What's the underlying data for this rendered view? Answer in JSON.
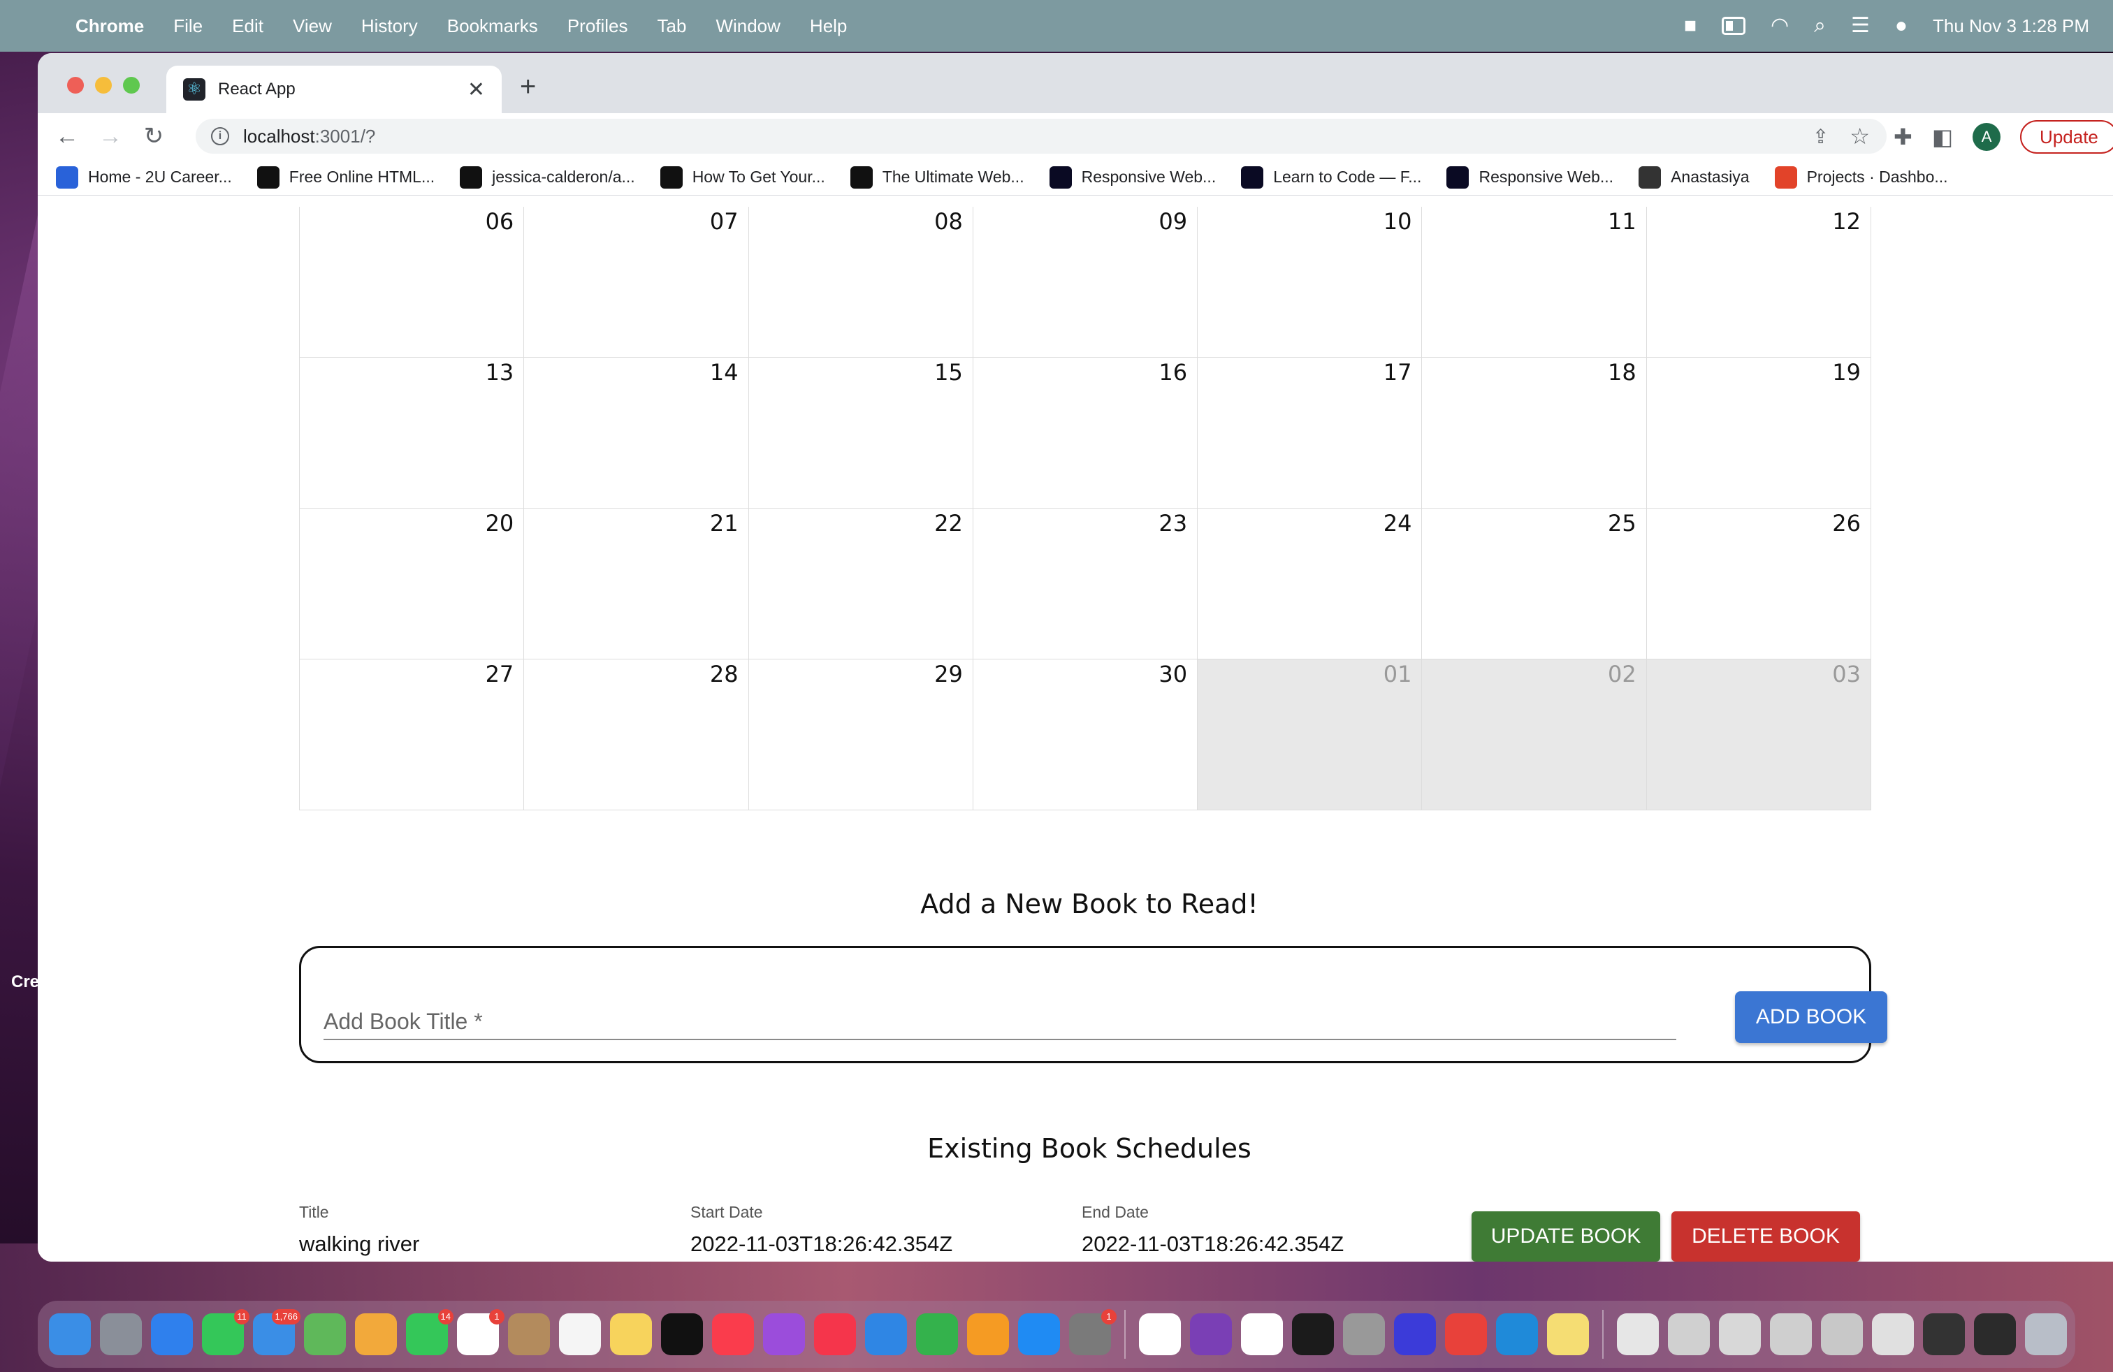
{
  "menubar": {
    "app_name": "Chrome",
    "menus": [
      "File",
      "Edit",
      "View",
      "History",
      "Bookmarks",
      "Profiles",
      "Tab",
      "Window",
      "Help"
    ],
    "datetime": "Thu Nov 3  1:28 PM"
  },
  "browser": {
    "tab_title": "React App",
    "url_host": "localhost",
    "url_path": ":3001/?",
    "profile_initial": "A",
    "update_label": "Update",
    "bookmarks": [
      {
        "label": "Home - 2U Career...",
        "icon": "2U",
        "color": "#2962d9"
      },
      {
        "label": "Free Online HTML...",
        "icon": "FF",
        "color": "#111111"
      },
      {
        "label": "jessica-calderon/a...",
        "icon": "GH",
        "color": "#111111"
      },
      {
        "label": "How To Get Your...",
        "icon": "CF",
        "color": "#111111"
      },
      {
        "label": "The Ultimate Web...",
        "icon": "CF",
        "color": "#111111"
      },
      {
        "label": "Responsive Web...",
        "icon": "FC",
        "color": "#0a0a23"
      },
      {
        "label": "Learn to Code — F...",
        "icon": "FC",
        "color": "#0a0a23"
      },
      {
        "label": "Responsive Web...",
        "icon": "FC",
        "color": "#0a0a23"
      },
      {
        "label": "Anastasiya",
        "icon": "AN",
        "color": "#333333"
      },
      {
        "label": "Projects · Dashbo...",
        "icon": "GL",
        "color": "#e24329"
      }
    ]
  },
  "calendar": {
    "days": [
      {
        "d": "06",
        "other": false
      },
      {
        "d": "07",
        "other": false
      },
      {
        "d": "08",
        "other": false
      },
      {
        "d": "09",
        "other": false
      },
      {
        "d": "10",
        "other": false
      },
      {
        "d": "11",
        "other": false
      },
      {
        "d": "12",
        "other": false
      },
      {
        "d": "13",
        "other": false
      },
      {
        "d": "14",
        "other": false
      },
      {
        "d": "15",
        "other": false
      },
      {
        "d": "16",
        "other": false
      },
      {
        "d": "17",
        "other": false
      },
      {
        "d": "18",
        "other": false
      },
      {
        "d": "19",
        "other": false
      },
      {
        "d": "20",
        "other": false
      },
      {
        "d": "21",
        "other": false
      },
      {
        "d": "22",
        "other": false
      },
      {
        "d": "23",
        "other": false
      },
      {
        "d": "24",
        "other": false
      },
      {
        "d": "25",
        "other": false
      },
      {
        "d": "26",
        "other": false
      },
      {
        "d": "27",
        "other": false
      },
      {
        "d": "28",
        "other": false
      },
      {
        "d": "29",
        "other": false
      },
      {
        "d": "30",
        "other": false
      },
      {
        "d": "01",
        "other": true
      },
      {
        "d": "02",
        "other": true
      },
      {
        "d": "03",
        "other": true
      }
    ]
  },
  "add_book": {
    "heading": "Add a New Book to Read!",
    "input_placeholder": "Add Book Title *",
    "input_value": "",
    "button_label": "ADD BOOK"
  },
  "existing": {
    "heading": "Existing Book Schedules",
    "title_label": "Title",
    "title_value": "walking river",
    "start_label": "Start Date",
    "start_value": "2022-11-03T18:26:42.354Z",
    "end_label": "End Date",
    "end_value": "2022-11-03T18:26:42.354Z",
    "update_label": "UPDATE BOOK",
    "delete_label": "DELETE BOOK"
  },
  "desktop": {
    "label": "Cre"
  },
  "dock": {
    "apps": [
      {
        "name": "finder",
        "color": "#3a8ee6",
        "badge": ""
      },
      {
        "name": "launchpad",
        "color": "#8a8f99",
        "badge": ""
      },
      {
        "name": "safari",
        "color": "#2f80ed",
        "badge": ""
      },
      {
        "name": "messages",
        "color": "#34c759",
        "badge": "11"
      },
      {
        "name": "mail",
        "color": "#3a8ee6",
        "badge": "1,766"
      },
      {
        "name": "maps",
        "color": "#5fb85a",
        "badge": ""
      },
      {
        "name": "photos",
        "color": "#f2a93b",
        "badge": ""
      },
      {
        "name": "facetime",
        "color": "#34c759",
        "badge": "14"
      },
      {
        "name": "calendar",
        "color": "#ffffff",
        "badge": "1"
      },
      {
        "name": "contacts",
        "color": "#b38b5d",
        "badge": ""
      },
      {
        "name": "reminders",
        "color": "#f5f5f5",
        "badge": ""
      },
      {
        "name": "notes",
        "color": "#f7d35c",
        "badge": ""
      },
      {
        "name": "tv",
        "color": "#111111",
        "badge": ""
      },
      {
        "name": "music",
        "color": "#fa3c4c",
        "badge": ""
      },
      {
        "name": "podcasts",
        "color": "#9b4ddb",
        "badge": ""
      },
      {
        "name": "news",
        "color": "#f5354b",
        "badge": ""
      },
      {
        "name": "keynote",
        "color": "#2f86e4",
        "badge": ""
      },
      {
        "name": "numbers",
        "color": "#34b24c",
        "badge": ""
      },
      {
        "name": "pages",
        "color": "#f59b23",
        "badge": ""
      },
      {
        "name": "app-store",
        "color": "#1f8bf3",
        "badge": ""
      },
      {
        "name": "system-preferences",
        "color": "#7a7a7a",
        "badge": "1"
      },
      {
        "name": "slack",
        "color": "#ffffff",
        "badge": ""
      },
      {
        "name": "onenote",
        "color": "#7a3fb5",
        "badge": ""
      },
      {
        "name": "chrome",
        "color": "#ffffff",
        "badge": ""
      },
      {
        "name": "terminal",
        "color": "#1b1b1b",
        "badge": ""
      },
      {
        "name": "color-picker",
        "color": "#999999",
        "badge": ""
      },
      {
        "name": "firefox-dev",
        "color": "#3b3bd9",
        "badge": ""
      },
      {
        "name": "mail-alt",
        "color": "#e8413a",
        "badge": ""
      },
      {
        "name": "vscode",
        "color": "#1f8ad9",
        "badge": ""
      },
      {
        "name": "stickies",
        "color": "#f5dd73",
        "badge": ""
      },
      {
        "name": "doc-1",
        "color": "#e6e6e6",
        "badge": ""
      },
      {
        "name": "doc-2",
        "color": "#d0d0d0",
        "badge": ""
      },
      {
        "name": "doc-3",
        "color": "#d8d8d8",
        "badge": ""
      },
      {
        "name": "doc-4",
        "color": "#cfcfcf",
        "badge": ""
      },
      {
        "name": "doc-5",
        "color": "#c8c8c8",
        "badge": ""
      },
      {
        "name": "doc-6",
        "color": "#e0e0e0",
        "badge": ""
      },
      {
        "name": "window-1",
        "color": "#333333",
        "badge": ""
      },
      {
        "name": "window-2",
        "color": "#2b2b2b",
        "badge": ""
      },
      {
        "name": "trash",
        "color": "#b8bec8",
        "badge": ""
      }
    ]
  }
}
